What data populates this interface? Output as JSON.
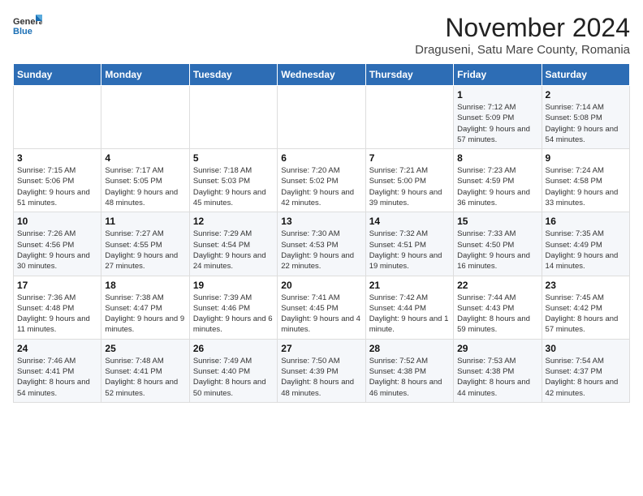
{
  "logo": {
    "line1": "General",
    "line2": "Blue"
  },
  "title": "November 2024",
  "subtitle": "Draguseni, Satu Mare County, Romania",
  "days_of_week": [
    "Sunday",
    "Monday",
    "Tuesday",
    "Wednesday",
    "Thursday",
    "Friday",
    "Saturday"
  ],
  "weeks": [
    [
      {
        "day": "",
        "info": ""
      },
      {
        "day": "",
        "info": ""
      },
      {
        "day": "",
        "info": ""
      },
      {
        "day": "",
        "info": ""
      },
      {
        "day": "",
        "info": ""
      },
      {
        "day": "1",
        "info": "Sunrise: 7:12 AM\nSunset: 5:09 PM\nDaylight: 9 hours and 57 minutes."
      },
      {
        "day": "2",
        "info": "Sunrise: 7:14 AM\nSunset: 5:08 PM\nDaylight: 9 hours and 54 minutes."
      }
    ],
    [
      {
        "day": "3",
        "info": "Sunrise: 7:15 AM\nSunset: 5:06 PM\nDaylight: 9 hours and 51 minutes."
      },
      {
        "day": "4",
        "info": "Sunrise: 7:17 AM\nSunset: 5:05 PM\nDaylight: 9 hours and 48 minutes."
      },
      {
        "day": "5",
        "info": "Sunrise: 7:18 AM\nSunset: 5:03 PM\nDaylight: 9 hours and 45 minutes."
      },
      {
        "day": "6",
        "info": "Sunrise: 7:20 AM\nSunset: 5:02 PM\nDaylight: 9 hours and 42 minutes."
      },
      {
        "day": "7",
        "info": "Sunrise: 7:21 AM\nSunset: 5:00 PM\nDaylight: 9 hours and 39 minutes."
      },
      {
        "day": "8",
        "info": "Sunrise: 7:23 AM\nSunset: 4:59 PM\nDaylight: 9 hours and 36 minutes."
      },
      {
        "day": "9",
        "info": "Sunrise: 7:24 AM\nSunset: 4:58 PM\nDaylight: 9 hours and 33 minutes."
      }
    ],
    [
      {
        "day": "10",
        "info": "Sunrise: 7:26 AM\nSunset: 4:56 PM\nDaylight: 9 hours and 30 minutes."
      },
      {
        "day": "11",
        "info": "Sunrise: 7:27 AM\nSunset: 4:55 PM\nDaylight: 9 hours and 27 minutes."
      },
      {
        "day": "12",
        "info": "Sunrise: 7:29 AM\nSunset: 4:54 PM\nDaylight: 9 hours and 24 minutes."
      },
      {
        "day": "13",
        "info": "Sunrise: 7:30 AM\nSunset: 4:53 PM\nDaylight: 9 hours and 22 minutes."
      },
      {
        "day": "14",
        "info": "Sunrise: 7:32 AM\nSunset: 4:51 PM\nDaylight: 9 hours and 19 minutes."
      },
      {
        "day": "15",
        "info": "Sunrise: 7:33 AM\nSunset: 4:50 PM\nDaylight: 9 hours and 16 minutes."
      },
      {
        "day": "16",
        "info": "Sunrise: 7:35 AM\nSunset: 4:49 PM\nDaylight: 9 hours and 14 minutes."
      }
    ],
    [
      {
        "day": "17",
        "info": "Sunrise: 7:36 AM\nSunset: 4:48 PM\nDaylight: 9 hours and 11 minutes."
      },
      {
        "day": "18",
        "info": "Sunrise: 7:38 AM\nSunset: 4:47 PM\nDaylight: 9 hours and 9 minutes."
      },
      {
        "day": "19",
        "info": "Sunrise: 7:39 AM\nSunset: 4:46 PM\nDaylight: 9 hours and 6 minutes."
      },
      {
        "day": "20",
        "info": "Sunrise: 7:41 AM\nSunset: 4:45 PM\nDaylight: 9 hours and 4 minutes."
      },
      {
        "day": "21",
        "info": "Sunrise: 7:42 AM\nSunset: 4:44 PM\nDaylight: 9 hours and 1 minute."
      },
      {
        "day": "22",
        "info": "Sunrise: 7:44 AM\nSunset: 4:43 PM\nDaylight: 8 hours and 59 minutes."
      },
      {
        "day": "23",
        "info": "Sunrise: 7:45 AM\nSunset: 4:42 PM\nDaylight: 8 hours and 57 minutes."
      }
    ],
    [
      {
        "day": "24",
        "info": "Sunrise: 7:46 AM\nSunset: 4:41 PM\nDaylight: 8 hours and 54 minutes."
      },
      {
        "day": "25",
        "info": "Sunrise: 7:48 AM\nSunset: 4:41 PM\nDaylight: 8 hours and 52 minutes."
      },
      {
        "day": "26",
        "info": "Sunrise: 7:49 AM\nSunset: 4:40 PM\nDaylight: 8 hours and 50 minutes."
      },
      {
        "day": "27",
        "info": "Sunrise: 7:50 AM\nSunset: 4:39 PM\nDaylight: 8 hours and 48 minutes."
      },
      {
        "day": "28",
        "info": "Sunrise: 7:52 AM\nSunset: 4:38 PM\nDaylight: 8 hours and 46 minutes."
      },
      {
        "day": "29",
        "info": "Sunrise: 7:53 AM\nSunset: 4:38 PM\nDaylight: 8 hours and 44 minutes."
      },
      {
        "day": "30",
        "info": "Sunrise: 7:54 AM\nSunset: 4:37 PM\nDaylight: 8 hours and 42 minutes."
      }
    ]
  ]
}
